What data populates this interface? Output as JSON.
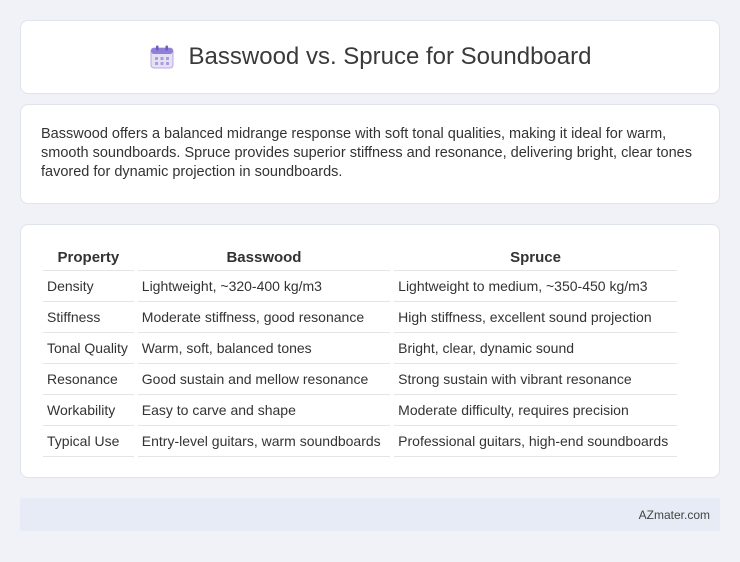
{
  "header": {
    "title": "Basswood vs. Spruce for Soundboard",
    "icon": "calendar-icon"
  },
  "intro": {
    "text": "Basswood offers a balanced midrange response with soft tonal qualities, making it ideal for warm, smooth soundboards. Spruce provides superior stiffness and resonance, delivering bright, clear tones favored for dynamic projection in soundboards."
  },
  "table": {
    "headers": [
      "Property",
      "Basswood",
      "Spruce"
    ],
    "rows": [
      [
        "Density",
        "Lightweight, ~320-400 kg/m3",
        "Lightweight to medium, ~350-450 kg/m3"
      ],
      [
        "Stiffness",
        "Moderate stiffness, good resonance",
        "High stiffness, excellent sound projection"
      ],
      [
        "Tonal Quality",
        "Warm, soft, balanced tones",
        "Bright, clear, dynamic sound"
      ],
      [
        "Resonance",
        "Good sustain and mellow resonance",
        "Strong sustain with vibrant resonance"
      ],
      [
        "Workability",
        "Easy to carve and shape",
        "Moderate difficulty, requires precision"
      ],
      [
        "Typical Use",
        "Entry-level guitars, warm soundboards",
        "Professional guitars, high-end soundboards"
      ]
    ]
  },
  "footer": {
    "text": "AZmater.com"
  }
}
